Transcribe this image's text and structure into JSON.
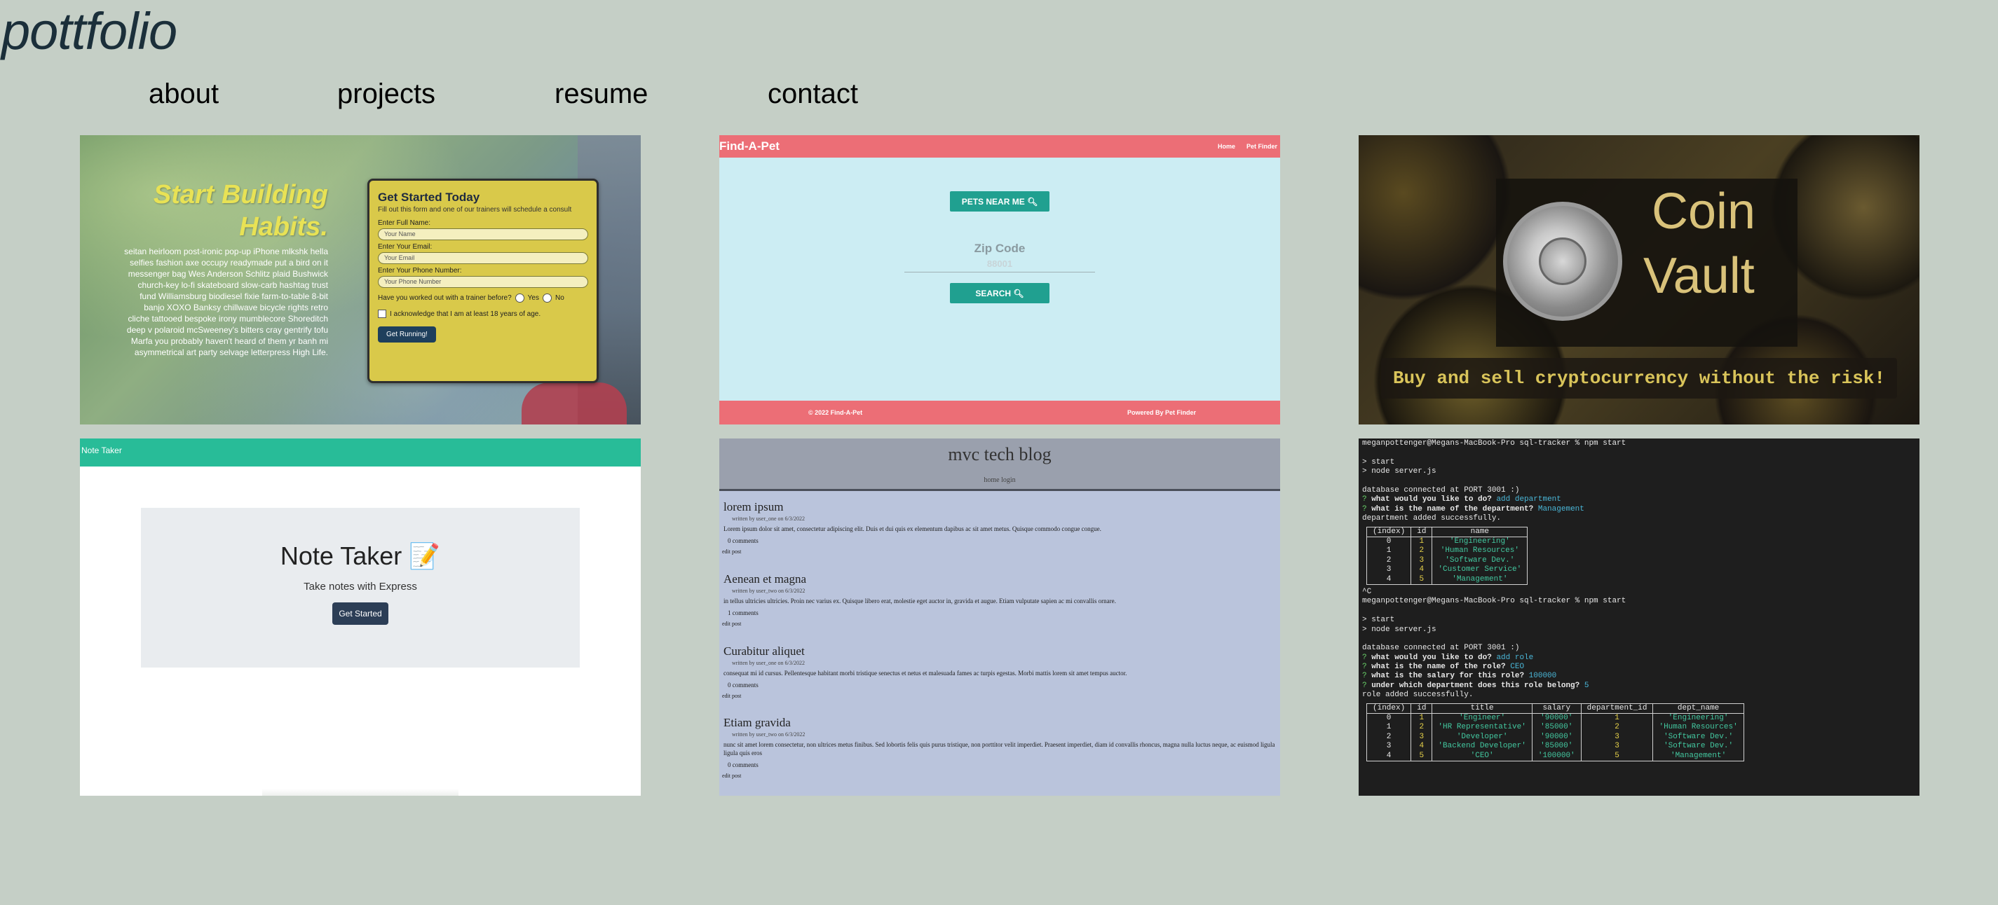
{
  "site": {
    "title": "pottfolio"
  },
  "nav": [
    "about",
    "projects",
    "resume",
    "contact"
  ],
  "fitness": {
    "headline_1": "Start Building",
    "headline_2": "Habits.",
    "lorem": "seitan heirloom post-ironic pop-up iPhone mlkshk hella selfies fashion axe occupy readymade put a bird on it messenger bag Wes Anderson Schlitz plaid Bushwick church-key lo-fi skateboard slow-carb hashtag trust fund Williamsburg biodiesel fixie farm-to-table 8-bit banjo XOXO Banksy chillwave bicycle rights retro cliche tattooed bespoke irony mumblecore Shoreditch deep v polaroid mcSweeney's bitters cray gentrify tofu Marfa you probably haven't heard of them yr banh mi asymmetrical art party selvage letterpress High Life.",
    "form_title": "Get Started Today",
    "form_sub": "Fill out this form and one of our trainers will schedule a consult",
    "name_label": "Enter Full Name:",
    "name_ph": "Your Name",
    "email_label": "Enter Your Email:",
    "email_ph": "Your Email",
    "phone_label": "Enter Your Phone Number:",
    "phone_ph": "Your Phone Number",
    "trainer_q": "Have you worked out with a trainer before?",
    "yes": "Yes",
    "no": "No",
    "ack": "I acknowledge that I am at least 18 years of age.",
    "submit": "Get Running!"
  },
  "pet": {
    "brand": "Find-A-Pet",
    "links": [
      "Home",
      "Pet Finder"
    ],
    "near_btn": "PETS NEAR ME",
    "zip_label": "Zip Code",
    "zip_ph": "88001",
    "search_btn": "SEARCH",
    "footer_left": "© 2022 Find-A-Pet",
    "footer_right": "Powered By Pet Finder"
  },
  "coin": {
    "title_1": "Coin",
    "title_2": "Vault",
    "banner": "Buy and sell cryptocurrency without the risk!"
  },
  "note": {
    "brand": "Note Taker",
    "heading": "Note Taker 📝",
    "sub": "Take notes with Express",
    "btn": "Get Started"
  },
  "blog": {
    "title": "mvc tech blog",
    "nav": "home login",
    "posts": [
      {
        "title": "lorem ipsum",
        "by": "written by user_one on 6/3/2022",
        "body": "Lorem ipsum dolor sit amet, consectetur adipiscing elit. Duis et dui quis ex elementum dapibus ac sit amet metus. Quisque commodo congue congue.",
        "comments": "0 comments",
        "edit": "edit post"
      },
      {
        "title": "Aenean et magna",
        "by": "written by user_two on 6/3/2022",
        "body": "in tellus ultricies ultricies. Proin nec varius ex. Quisque libero erat, molestie eget auctor in, gravida et augue. Etiam vulputate sapien ac mi convallis ornare.",
        "comments": "1 comments",
        "edit": "edit post"
      },
      {
        "title": "Curabitur aliquet",
        "by": "written by user_one on 6/3/2022",
        "body": "consequat mi id cursus. Pellentesque habitant morbi tristique senectus et netus et malesuada fames ac turpis egestas. Morbi mattis lorem sit amet tempus auctor.",
        "comments": "0 comments",
        "edit": "edit post"
      },
      {
        "title": "Etiam gravida",
        "by": "written by user_two on 6/3/2022",
        "body": "nunc sit amet lorem consectetur, non ultrices metus finibus. Sed lobortis felis quis purus tristique, non porttitor velit imperdiet. Praesent imperdiet, diam id convallis rhoncus, magna nulla luctus neque, ac euismod ligula ligula quis eros",
        "comments": "0 comments",
        "edit": "edit post"
      }
    ]
  },
  "terminal": {
    "prompt1": "meganpottenger@Megans-MacBook-Pro sql-tracker % npm start",
    "start": "> start",
    "node": "> node server.js",
    "db": "database connected at PORT 3001 :)",
    "q1": "what would you like to do?",
    "a1": "add department",
    "q2": "what is the name of the department?",
    "a2": "Management",
    "done1": "department added successfully.",
    "t1_head": [
      "(index)",
      "id",
      "name"
    ],
    "t1_rows": [
      [
        "0",
        "1",
        "'Engineering'"
      ],
      [
        "1",
        "2",
        "'Human Resources'"
      ],
      [
        "2",
        "3",
        "'Software Dev.'"
      ],
      [
        "3",
        "4",
        "'Customer Service'"
      ],
      [
        "4",
        "5",
        "'Management'"
      ]
    ],
    "ctrlc": "^C",
    "prompt2": "meganpottenger@Megans-MacBook-Pro sql-tracker % npm start",
    "q3": "what would you like to do?",
    "a3": "add role",
    "q4": "what is the name of the role?",
    "a4": "CEO",
    "q5": "what is the salary for this role?",
    "a5": "100000",
    "q6": "under which department does this role belong?",
    "a6": "5",
    "done2": "role added successfully.",
    "t2_head": [
      "(index)",
      "id",
      "title",
      "salary",
      "department_id",
      "dept_name"
    ],
    "t2_rows": [
      [
        "0",
        "1",
        "'Engineer'",
        "'90000'",
        "1",
        "'Engineering'"
      ],
      [
        "1",
        "2",
        "'HR Representative'",
        "'85000'",
        "2",
        "'Human Resources'"
      ],
      [
        "2",
        "3",
        "'Developer'",
        "'90000'",
        "3",
        "'Software Dev.'"
      ],
      [
        "3",
        "4",
        "'Backend Developer'",
        "'85000'",
        "3",
        "'Software Dev.'"
      ],
      [
        "4",
        "5",
        "'CEO'",
        "'100000'",
        "5",
        "'Management'"
      ]
    ]
  }
}
